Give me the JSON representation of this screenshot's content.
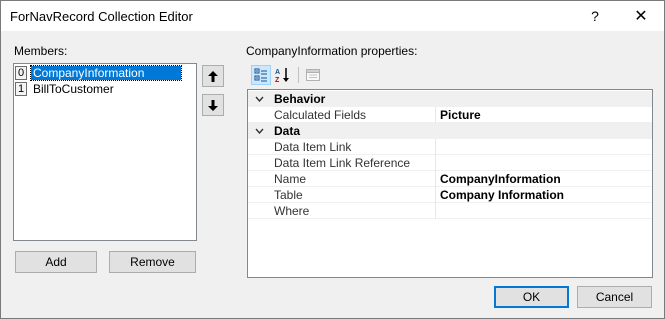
{
  "window": {
    "title": "ForNavRecord Collection Editor",
    "help_glyph": "?",
    "close_glyph": "✕"
  },
  "members": {
    "label": "Members:",
    "items": [
      {
        "index": "0",
        "label": "CompanyInformation",
        "selected": true
      },
      {
        "index": "1",
        "label": "BillToCustomer",
        "selected": false
      }
    ],
    "move_up_icon": "arrow-up-icon",
    "move_down_icon": "arrow-down-icon",
    "add_label": "Add",
    "remove_label": "Remove"
  },
  "properties": {
    "label": "CompanyInformation properties:",
    "toolbar": {
      "categorized_icon": "categorized-icon",
      "alphabetical_icon": "alphabetical-icon",
      "property_pages_icon": "property-pages-icon"
    },
    "categories": [
      {
        "name": "Behavior",
        "rows": [
          {
            "name": "Calculated Fields",
            "value": "Picture"
          }
        ]
      },
      {
        "name": "Data",
        "rows": [
          {
            "name": "Data Item Link",
            "value": ""
          },
          {
            "name": "Data Item Link Reference",
            "value": ""
          },
          {
            "name": "Name",
            "value": "CompanyInformation"
          },
          {
            "name": "Table",
            "value": "Company Information"
          },
          {
            "name": "Where",
            "value": ""
          }
        ]
      }
    ]
  },
  "footer": {
    "ok_label": "OK",
    "cancel_label": "Cancel"
  },
  "colors": {
    "selection": "#0078d7",
    "dialog_bg": "#f0f0f0"
  }
}
